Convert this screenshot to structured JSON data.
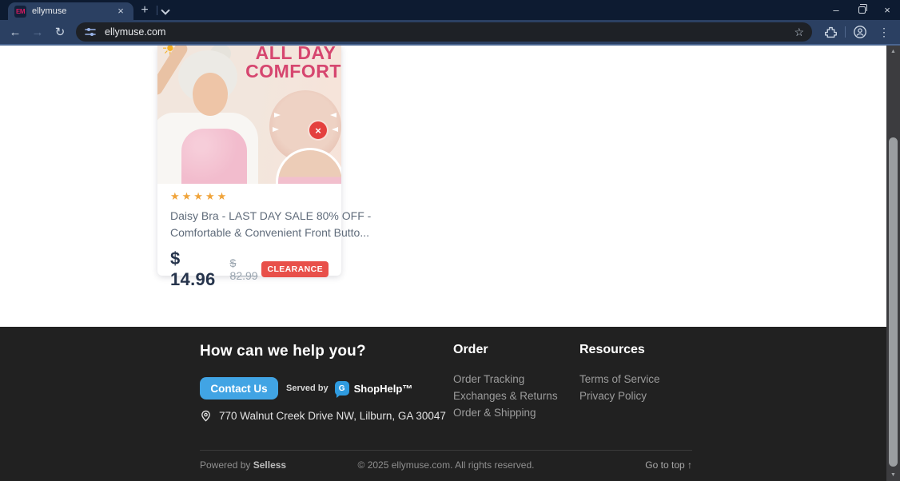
{
  "browser": {
    "tab_title": "ellymuse",
    "favicon_text": "EM",
    "url": "ellymuse.com",
    "glyphs": {
      "close_tab": "×",
      "new_tab": "+",
      "minimize": "–",
      "close_window": "×",
      "back": "←",
      "forward": "→",
      "refresh": "↻",
      "bookmark_star": "☆",
      "kebab": "⋮",
      "scroll_up": "▲",
      "scroll_down": "▼"
    }
  },
  "product": {
    "image_text_line1": "ALL DAY",
    "image_text_line2": "COMFORT",
    "sun_glyph": "☀",
    "x_mark": "×",
    "rating_stars": "★★★★★",
    "title_line1": "Daisy Bra - LAST DAY SALE 80% OFF -",
    "title_line2": "Comfortable & Convenient Front Butto...",
    "price": "$ 14.96",
    "old_price": "$ 82.99",
    "badge": "CLEARANCE",
    "badge_color": "#e8504a",
    "accent_pink": "#d6466f"
  },
  "footer": {
    "heading": "How can we help you?",
    "contact_button": "Contact Us",
    "served_by_label": "Served by",
    "shophelp_logo_letter": "G",
    "shophelp_name": "ShopHelp™",
    "address": "770 Walnut Creek Drive NW, Lilburn, GA 30047",
    "columns": [
      {
        "heading": "Order",
        "links": [
          "Order Tracking",
          "Exchanges & Returns",
          "Order & Shipping"
        ]
      },
      {
        "heading": "Resources",
        "links": [
          "Terms of Service",
          "Privacy Policy"
        ]
      }
    ],
    "powered_by_label": "Powered by",
    "powered_by_brand": "Selless",
    "copyright": "© 2025 ellymuse.com. All rights reserved.",
    "go_to_top": "Go to top ↑",
    "contact_button_color": "#41a4e4"
  }
}
